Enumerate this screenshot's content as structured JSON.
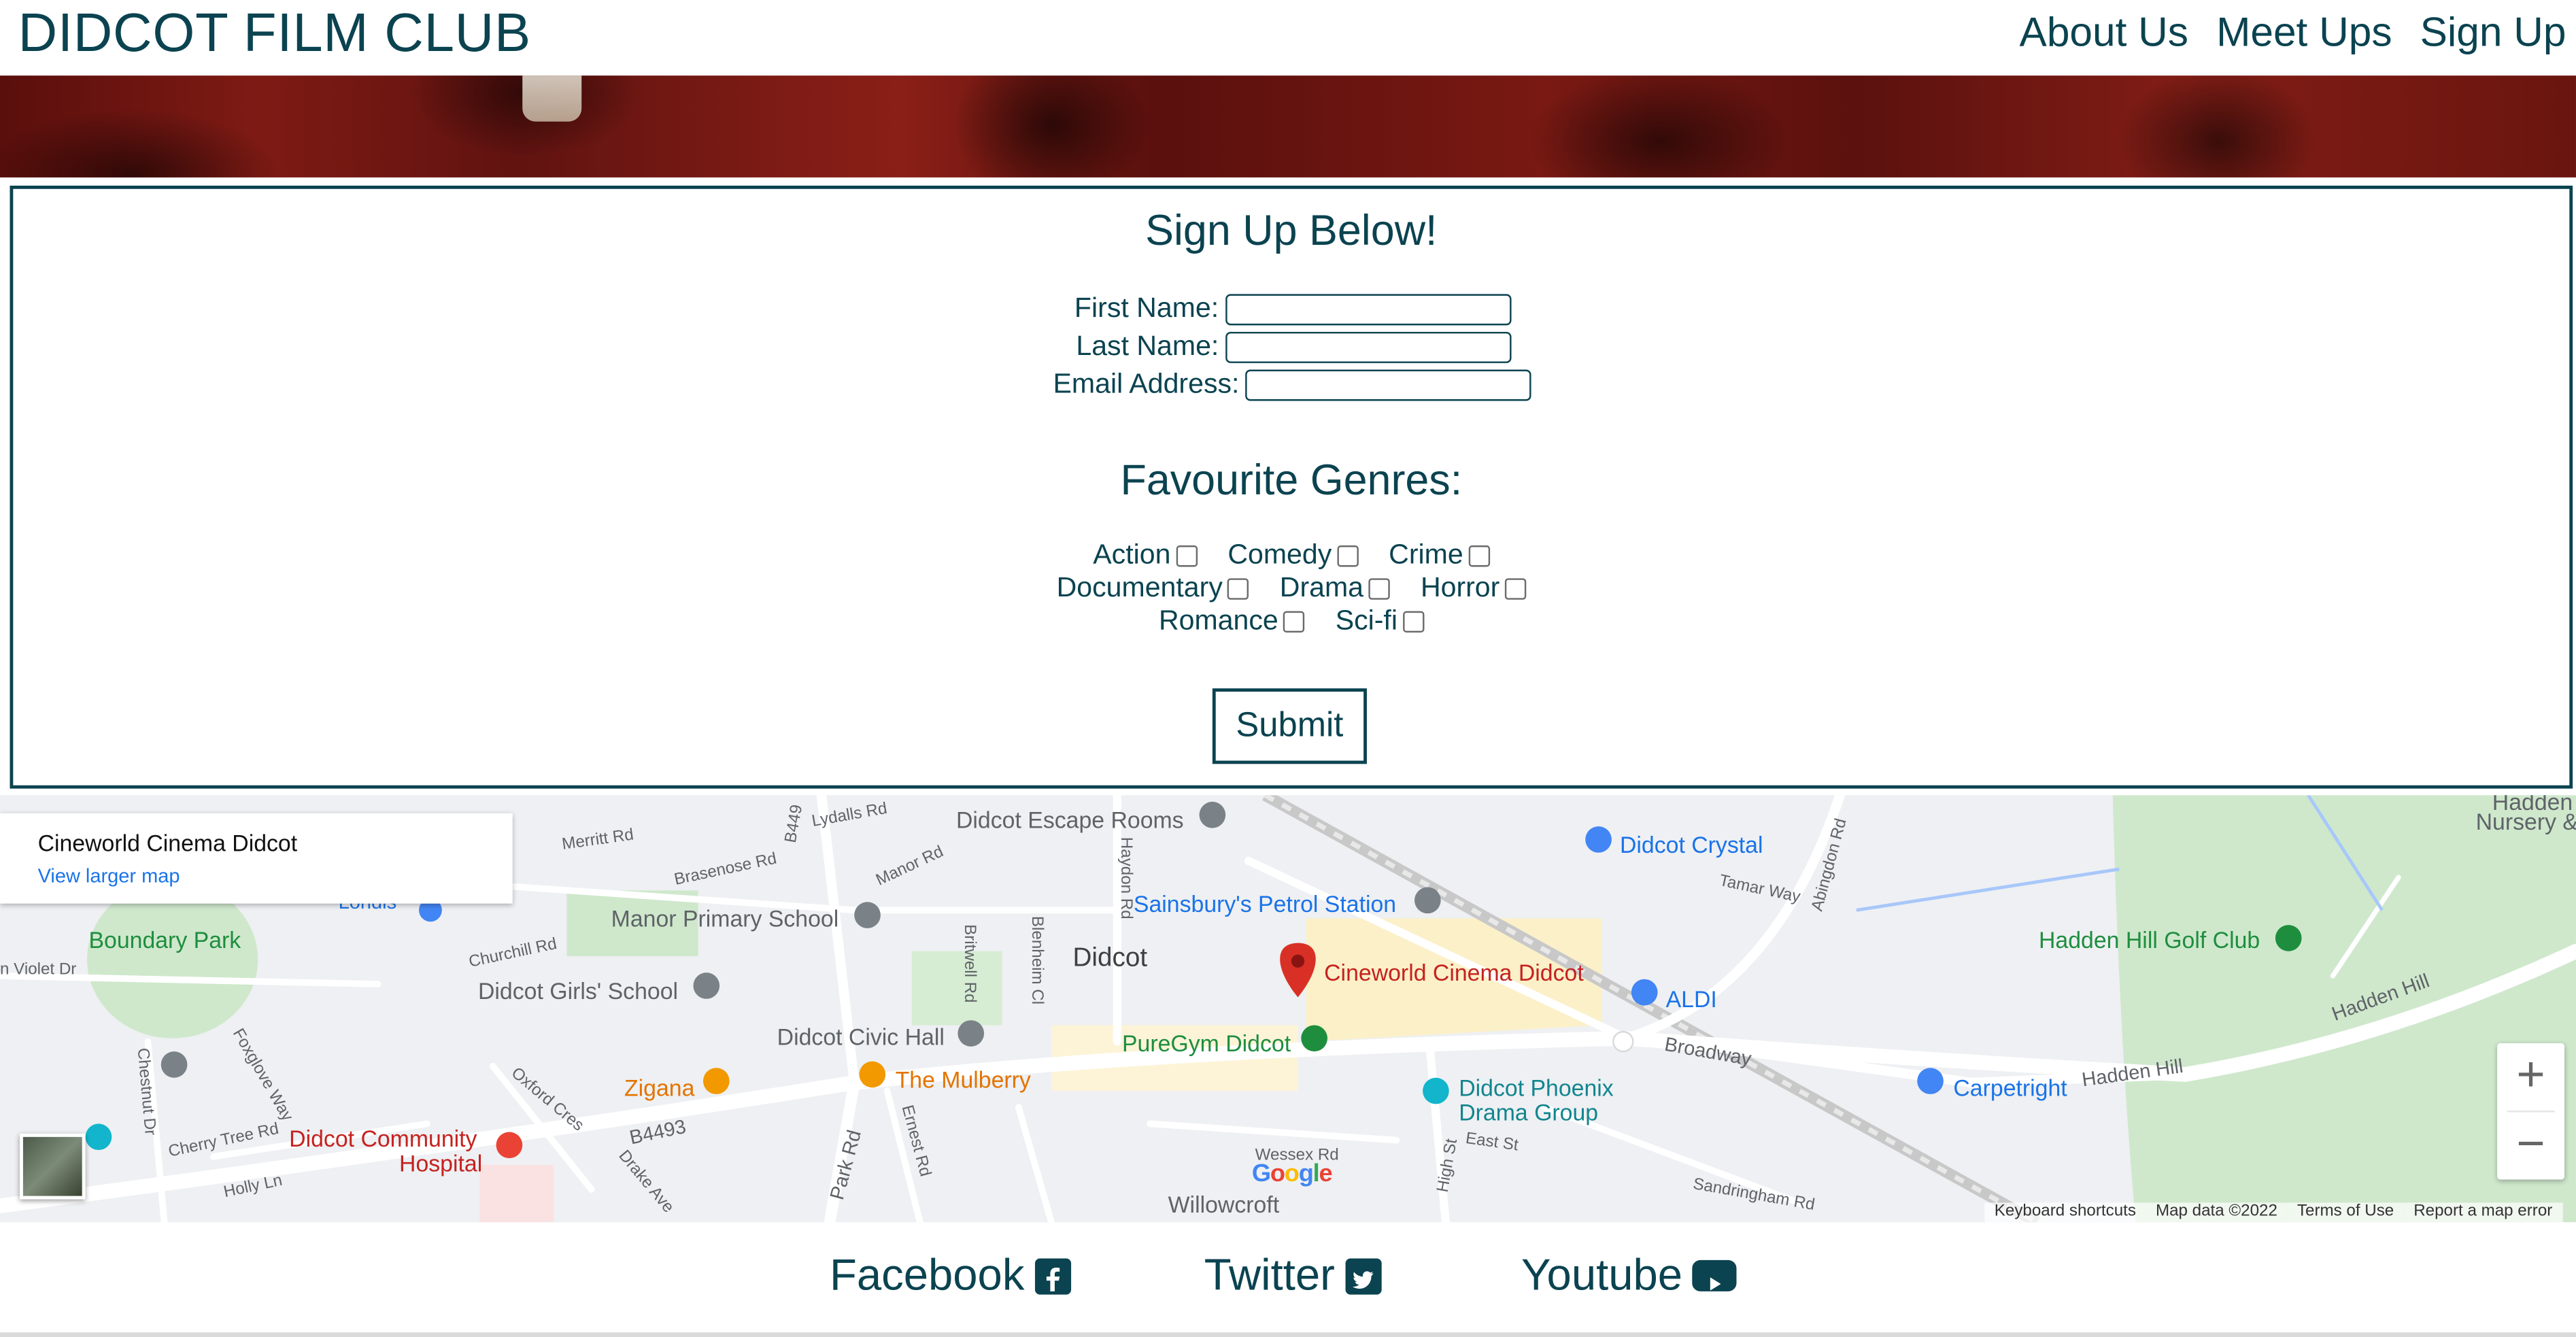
{
  "header": {
    "brand": "DIDCOT FILM CLUB",
    "nav": [
      "About Us",
      "Meet Ups",
      "Sign Up"
    ]
  },
  "form": {
    "title": "Sign Up Below!",
    "first_name_label": "First Name:",
    "last_name_label": "Last Name:",
    "email_label": "Email Address:",
    "genres_title": "Favourite Genres:",
    "genres": [
      "Action",
      "Comedy",
      "Crime",
      "Documentary",
      "Drama",
      "Horror",
      "Romance",
      "Sci-fi"
    ],
    "submit_label": "Submit"
  },
  "map": {
    "place_title": "Cineworld Cinema Didcot",
    "larger_map_link": "View larger map",
    "labels": {
      "didcot": "Didcot",
      "cinema": "Cineworld Cinema Didcot",
      "escape": "Didcot Escape Rooms",
      "crystal": "Didcot Crystal",
      "sainsburys": "Sainsbury's Petrol Station",
      "aldi": "ALDI",
      "manor": "Manor Primary School",
      "boundary": "Boundary Park",
      "girls": "Didcot Girls' School",
      "civic": "Didcot Civic Hall",
      "puregym": "PureGym Didcot",
      "zigana": "Zigana",
      "mulberry": "The Mulberry",
      "phoenix_1": "Didcot Phoenix",
      "phoenix_2": "Drama Group",
      "hospital_1": "Didcot Community",
      "hospital_2": "Hospital",
      "hadden_golf": "Hadden Hill Golf Club",
      "hadden_nursery_1": "Hadden",
      "hadden_nursery_2": "Nursery &",
      "carpetright": "Carpetright",
      "willowcroft": "Willowcroft",
      "londis": "Londis",
      "broadway": "Broadway",
      "hadden_hill": "Hadden Hill",
      "hadden_hill_2": "Hadden Hill",
      "b4493": "B4493",
      "park_rd": "Park Rd",
      "lydalls": "Lydalls Rd",
      "merritt": "Merritt Rd",
      "brasenose": "Brasenose Rd",
      "manor_rd": "Manor Rd",
      "haydon": "Haydon Rd",
      "churchill": "Churchill Rd",
      "britwell": "Britwell Rd",
      "blenheim": "Blenheim Cl",
      "abingdon": "Abingdon Rd",
      "tamar": "Tamar Way",
      "oxford_cres": "Oxford Cres",
      "cherry": "Cherry Tree Rd",
      "holly": "Holly Ln",
      "drake": "Drake Ave",
      "ernest": "Ernest Rd",
      "wessex": "Wessex Rd",
      "east_st": "East St",
      "high_st": "High St",
      "sandringham": "Sandringham Rd",
      "chestnut": "Chestnut Dr",
      "foxglove": "Foxglove Way",
      "violet": "n Violet Dr",
      "b449": "B449"
    },
    "attribution": [
      "Keyboard shortcuts",
      "Map data ©2022",
      "Terms of Use",
      "Report a map error"
    ],
    "zoom_in": "+",
    "zoom_out": "−",
    "google": "Google"
  },
  "footer": {
    "facebook": "Facebook",
    "twitter": "Twitter",
    "youtube": "Youtube"
  },
  "colors": {
    "brand": "#0b4350",
    "map_bg": "#eef0f3",
    "pin": "#d93025"
  }
}
